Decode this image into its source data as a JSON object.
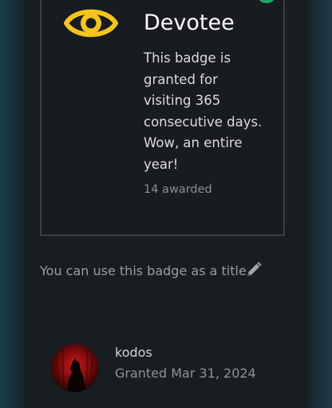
{
  "badge": {
    "name": "Devotee",
    "description": "This badge is granted for visiting 365 consecutive days. Wow, an entire year!",
    "awarded": "14 awarded",
    "icon": "eye-icon",
    "icon_color": "#f5c518"
  },
  "title_hint": {
    "text": "You can use this badge as a title",
    "icon": "pencil-icon"
  },
  "grant": {
    "username": "kodos",
    "granted_label": "Granted",
    "granted_date": "Mar 31, 2024"
  },
  "colors": {
    "status_dot": "#1aa56a",
    "card_border": "#3a3f44"
  }
}
